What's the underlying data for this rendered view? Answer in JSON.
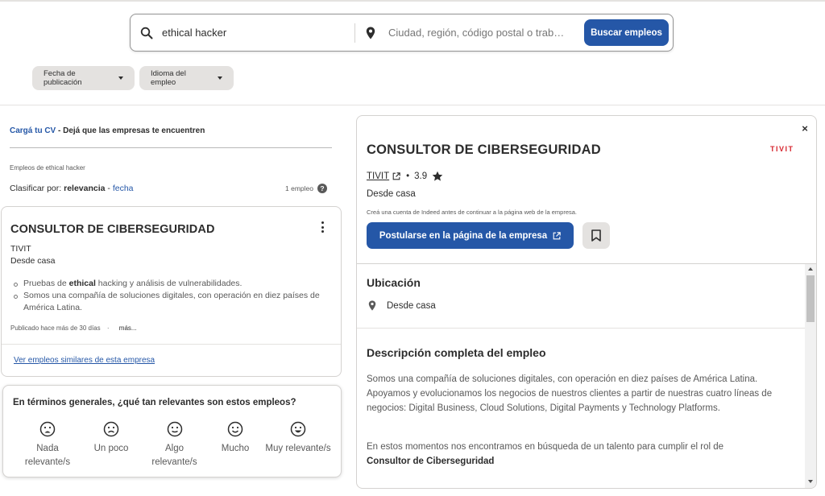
{
  "search": {
    "what_value": "ethical hacker",
    "where_placeholder": "Ciudad, región, código postal o trab…",
    "button_label": "Buscar empleos"
  },
  "filters": [
    {
      "label": "Fecha de publicación"
    },
    {
      "label": "Idioma del empleo"
    }
  ],
  "upload": {
    "link": "Cargá tu CV",
    "text": " - Dejá que las empresas te encuentren"
  },
  "results": {
    "heading": "Empleos de ethical hacker",
    "sort_prefix": "Clasificar por: ",
    "sort_active": "relevancia",
    "sort_sep": " - ",
    "sort_other": "fecha",
    "count": "1 empleo",
    "help_glyph": "?"
  },
  "job_card": {
    "title": "CONSULTOR DE CIBERSEGURIDAD",
    "company": "TIVIT",
    "location": "Desde casa",
    "bullet1_pre": "Pruebas de ",
    "bullet1_bold": "ethical",
    "bullet1_post": " hacking y análisis de vulnerabilidades.",
    "bullet2": "Somos una compañía de soluciones digitales, con operación en diez países de América Latina.",
    "posted": "Publicado hace más de 30 días",
    "posted_sep": "·",
    "more": "más...",
    "similar_link": "Ver empleos similares de esta empresa"
  },
  "survey": {
    "question": "En términos generales, ¿qué tan relevantes son estos empleos?",
    "options": [
      {
        "label": "Nada relevante/s"
      },
      {
        "label": "Un poco"
      },
      {
        "label": "Algo relevante/s"
      },
      {
        "label": "Mucho"
      },
      {
        "label": "Muy relevante/s"
      }
    ]
  },
  "detail": {
    "close_glyph": "×",
    "logo_text": "TIVIT",
    "title": "CONSULTOR DE CIBERSEGURIDAD",
    "company": "TIVIT",
    "rating_sep": "•",
    "rating": "3.9",
    "location": "Desde casa",
    "note": "Creá una cuenta de Indeed antes de continuar a la página web de la empresa.",
    "apply_label": "Postularse en la página de la empresa",
    "location_heading": "Ubicación",
    "location_value": "Desde casa",
    "description_heading": "Descripción completa del empleo",
    "description_p1": "Somos una compañía de soluciones digitales, con operación en diez países de América Latina. Apoyamos y evolucionamos los negocios de nuestros clientes a partir de nuestras cuatro líneas de negocios: Digital Business, Cloud Solutions, Digital Payments y Technology Platforms.",
    "description_p2": "En estos momentos nos encontramos en búsqueda de un talento para cumplir el rol de ",
    "description_p2_bold": "Consultor de Ciberseguridad"
  },
  "colors": {
    "primary_blue": "#2557a7",
    "chip_gray": "#e4e2e0",
    "logo_red": "#d7262f",
    "text": "#2d2d2d"
  }
}
